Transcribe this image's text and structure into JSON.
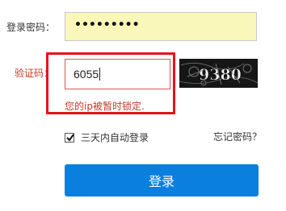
{
  "form": {
    "password_label": "登录密码：",
    "password_masked": "•••••••••",
    "captcha_label": "验证码：",
    "captcha_value": "6055",
    "error_message": "您的ip被暂时锁定.",
    "captcha_image_text": "9380",
    "remember_label": "三天内自动登录",
    "remember_checked": true,
    "forgot_link": "忘记密码？",
    "login_button": "登录"
  },
  "colors": {
    "password_bg": "#f9f7b9",
    "error_red": "#c0392b",
    "highlight_box": "#e4141b",
    "button_blue": "#0a7fde"
  }
}
